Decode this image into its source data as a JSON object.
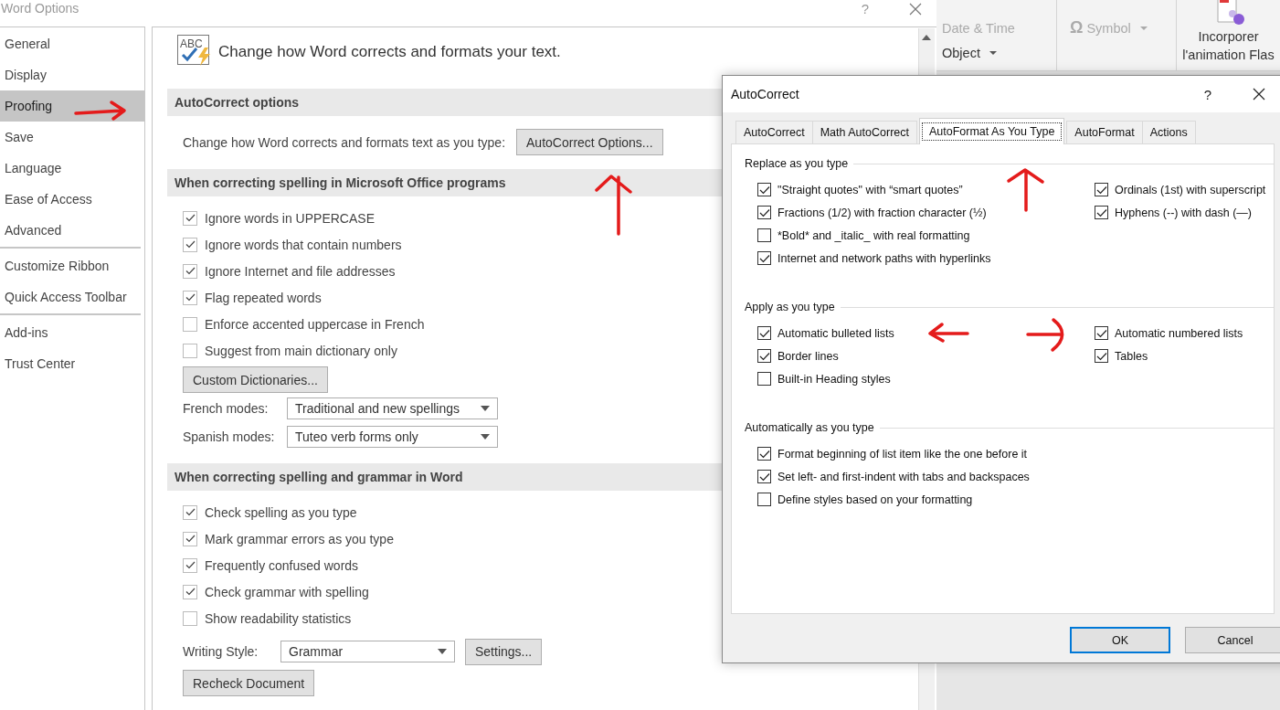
{
  "main_window": {
    "title": "Word Options",
    "help": "?"
  },
  "sidebar": {
    "groups": [
      {
        "items": [
          {
            "label": "General",
            "selected": false
          },
          {
            "label": "Display",
            "selected": false
          },
          {
            "label": "Proofing",
            "selected": true
          },
          {
            "label": "Save",
            "selected": false
          },
          {
            "label": "Language",
            "selected": false
          },
          {
            "label": "Ease of Access",
            "selected": false
          },
          {
            "label": "Advanced",
            "selected": false
          }
        ]
      },
      {
        "items": [
          {
            "label": "Customize Ribbon",
            "selected": false
          },
          {
            "label": "Quick Access Toolbar",
            "selected": false
          }
        ]
      },
      {
        "items": [
          {
            "label": "Add-ins",
            "selected": false
          },
          {
            "label": "Trust Center",
            "selected": false
          }
        ]
      }
    ]
  },
  "header": {
    "text": "Change how Word corrects and formats your text.",
    "icon_text": "ABC"
  },
  "sections": [
    {
      "title": "AutoCorrect options",
      "rows": [
        {
          "kind": "label_button",
          "label": "Change how Word corrects and formats text as you type:",
          "button": "AutoCorrect Options..."
        }
      ]
    },
    {
      "title": "When correcting spelling in Microsoft Office programs",
      "rows": [
        {
          "kind": "checkbox",
          "label": "Ignore words in UPPERCASE",
          "checked": true
        },
        {
          "kind": "checkbox",
          "label": "Ignore words that contain numbers",
          "checked": true
        },
        {
          "kind": "checkbox",
          "label": "Ignore Internet and file addresses",
          "checked": true
        },
        {
          "kind": "checkbox",
          "label": "Flag repeated words",
          "checked": true
        },
        {
          "kind": "checkbox",
          "label": "Enforce accented uppercase in French",
          "checked": false
        },
        {
          "kind": "checkbox",
          "label": "Suggest from main dictionary only",
          "checked": false
        },
        {
          "kind": "button",
          "button": "Custom Dictionaries..."
        },
        {
          "kind": "dropdown",
          "label": "French modes:",
          "value": "Traditional and new spellings"
        },
        {
          "kind": "dropdown",
          "label": "Spanish modes:",
          "value": "Tuteo verb forms only"
        }
      ]
    },
    {
      "title": "When correcting spelling and grammar in Word",
      "rows": [
        {
          "kind": "checkbox",
          "label": "Check spelling as you type",
          "checked": true
        },
        {
          "kind": "checkbox",
          "label": "Mark grammar errors as you type",
          "checked": true
        },
        {
          "kind": "checkbox",
          "label": "Frequently confused words",
          "checked": true
        },
        {
          "kind": "checkbox",
          "label": "Check grammar with spelling",
          "checked": true
        },
        {
          "kind": "checkbox",
          "label": "Show readability statistics",
          "checked": false
        },
        {
          "kind": "dropdown_button",
          "label": "Writing Style:",
          "value": "Grammar",
          "button": "Settings..."
        },
        {
          "kind": "button",
          "button": "Recheck Document"
        }
      ]
    }
  ],
  "ribbon": {
    "items": [
      {
        "label": "Date & Time",
        "disabled": true,
        "dropdown": false
      },
      {
        "label": "Object",
        "disabled": false,
        "dropdown": true
      },
      {
        "label": "Symbol",
        "disabled": true,
        "dropdown": true,
        "glyph": "Ω"
      }
    ],
    "large_button": {
      "lines": [
        "Incorporer",
        "l'animation Flas"
      ]
    }
  },
  "dialog": {
    "title": "AutoCorrect",
    "help": "?",
    "tabs": [
      {
        "label": "AutoCorrect",
        "selected": false
      },
      {
        "label": "Math AutoCorrect",
        "selected": false
      },
      {
        "label": "AutoFormat As You Type",
        "selected": true
      },
      {
        "label": "AutoFormat",
        "selected": false
      },
      {
        "label": "Actions",
        "selected": false
      }
    ],
    "groups": [
      {
        "title": "Replace as you type",
        "columns": [
          [
            {
              "label": "\"Straight quotes\" with “smart quotes”",
              "checked": true
            },
            {
              "label": "Fractions (1/2) with fraction character (½)",
              "checked": true
            },
            {
              "label": "*Bold* and _italic_ with real formatting",
              "checked": false
            },
            {
              "label": "Internet and network paths with hyperlinks",
              "checked": true
            }
          ],
          [
            {
              "label": "Ordinals (1st) with superscript",
              "checked": true
            },
            {
              "label": "Hyphens (--) with dash (—)",
              "checked": true
            }
          ]
        ]
      },
      {
        "title": "Apply as you type",
        "columns": [
          [
            {
              "label": "Automatic bulleted lists",
              "checked": true
            },
            {
              "label": "Border lines",
              "checked": true
            },
            {
              "label": "Built-in Heading styles",
              "checked": false
            }
          ],
          [
            {
              "label": "Automatic numbered lists",
              "checked": true
            },
            {
              "label": "Tables",
              "checked": true
            }
          ]
        ]
      },
      {
        "title": "Automatically as you type",
        "columns": [
          [
            {
              "label": "Format beginning of list item like the one before it",
              "checked": true
            },
            {
              "label": "Set left- and first-indent with tabs and backspaces",
              "checked": true
            },
            {
              "label": "Define styles based on your formatting",
              "checked": false
            }
          ]
        ]
      }
    ],
    "buttons": [
      {
        "label": "OK",
        "default": true
      },
      {
        "label": "Cancel",
        "default": false
      }
    ]
  }
}
